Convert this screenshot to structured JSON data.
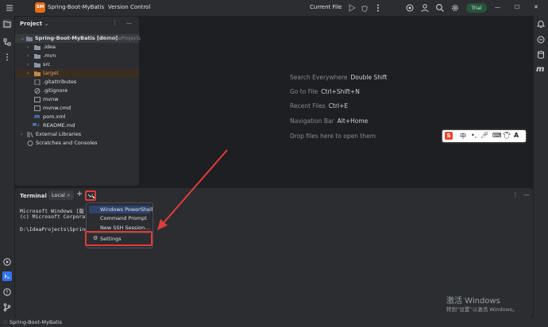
{
  "titlebar": {
    "project_badge": "SM",
    "project_name": "Spring-Boot-MyBatis",
    "vcs": "Version Control",
    "run_config": "Current File",
    "trial": "Trial"
  },
  "project_panel": {
    "title": "Project",
    "root_name": "Spring-Boot-MyBatis [demo]",
    "root_path": "D:\\IdeaProjects\\",
    "items": [
      {
        "label": ".idea"
      },
      {
        "label": ".mvn"
      },
      {
        "label": "src"
      },
      {
        "label": "target"
      },
      {
        "label": ".gitattributes"
      },
      {
        "label": ".gitignore"
      },
      {
        "label": "mvnw"
      },
      {
        "label": "mvnw.cmd"
      },
      {
        "label": "pom.xml"
      },
      {
        "label": "README.md"
      }
    ],
    "external_libraries": "External Libraries",
    "scratches": "Scratches and Consoles"
  },
  "editor": {
    "hints": [
      {
        "action": "Search Everywhere",
        "shortcut": "Double Shift"
      },
      {
        "action": "Go to File",
        "shortcut": "Ctrl+Shift+N"
      },
      {
        "action": "Recent Files",
        "shortcut": "Ctrl+E"
      },
      {
        "action": "Navigation Bar",
        "shortcut": "Alt+Home"
      }
    ],
    "drop_hint": "Drop files here to open them"
  },
  "ime": {
    "logo": "S",
    "lang": "中",
    "punct": "•,"
  },
  "terminal": {
    "title": "Terminal",
    "tab": "Local",
    "add": "+",
    "lines": [
      "Microsoft Windows [版",
      "(c) Microsoft Corporat"
    ],
    "prompt": "D:\\IdeaProjects\\Spring"
  },
  "dropdown": {
    "items": [
      "Windows PowerShell",
      "Command Prompt",
      "New SSH Session..."
    ],
    "settings": "Settings"
  },
  "status": {
    "project": "Spring-Boot-MyBatis"
  },
  "watermark": {
    "title": "激活 Windows",
    "subtitle": "转到“设置”以激活 Windows。"
  },
  "colors": {
    "accent": "#3574f0",
    "highlight_red": "#e03b3b",
    "badge": "#e66d17",
    "trial": "#26543b"
  }
}
